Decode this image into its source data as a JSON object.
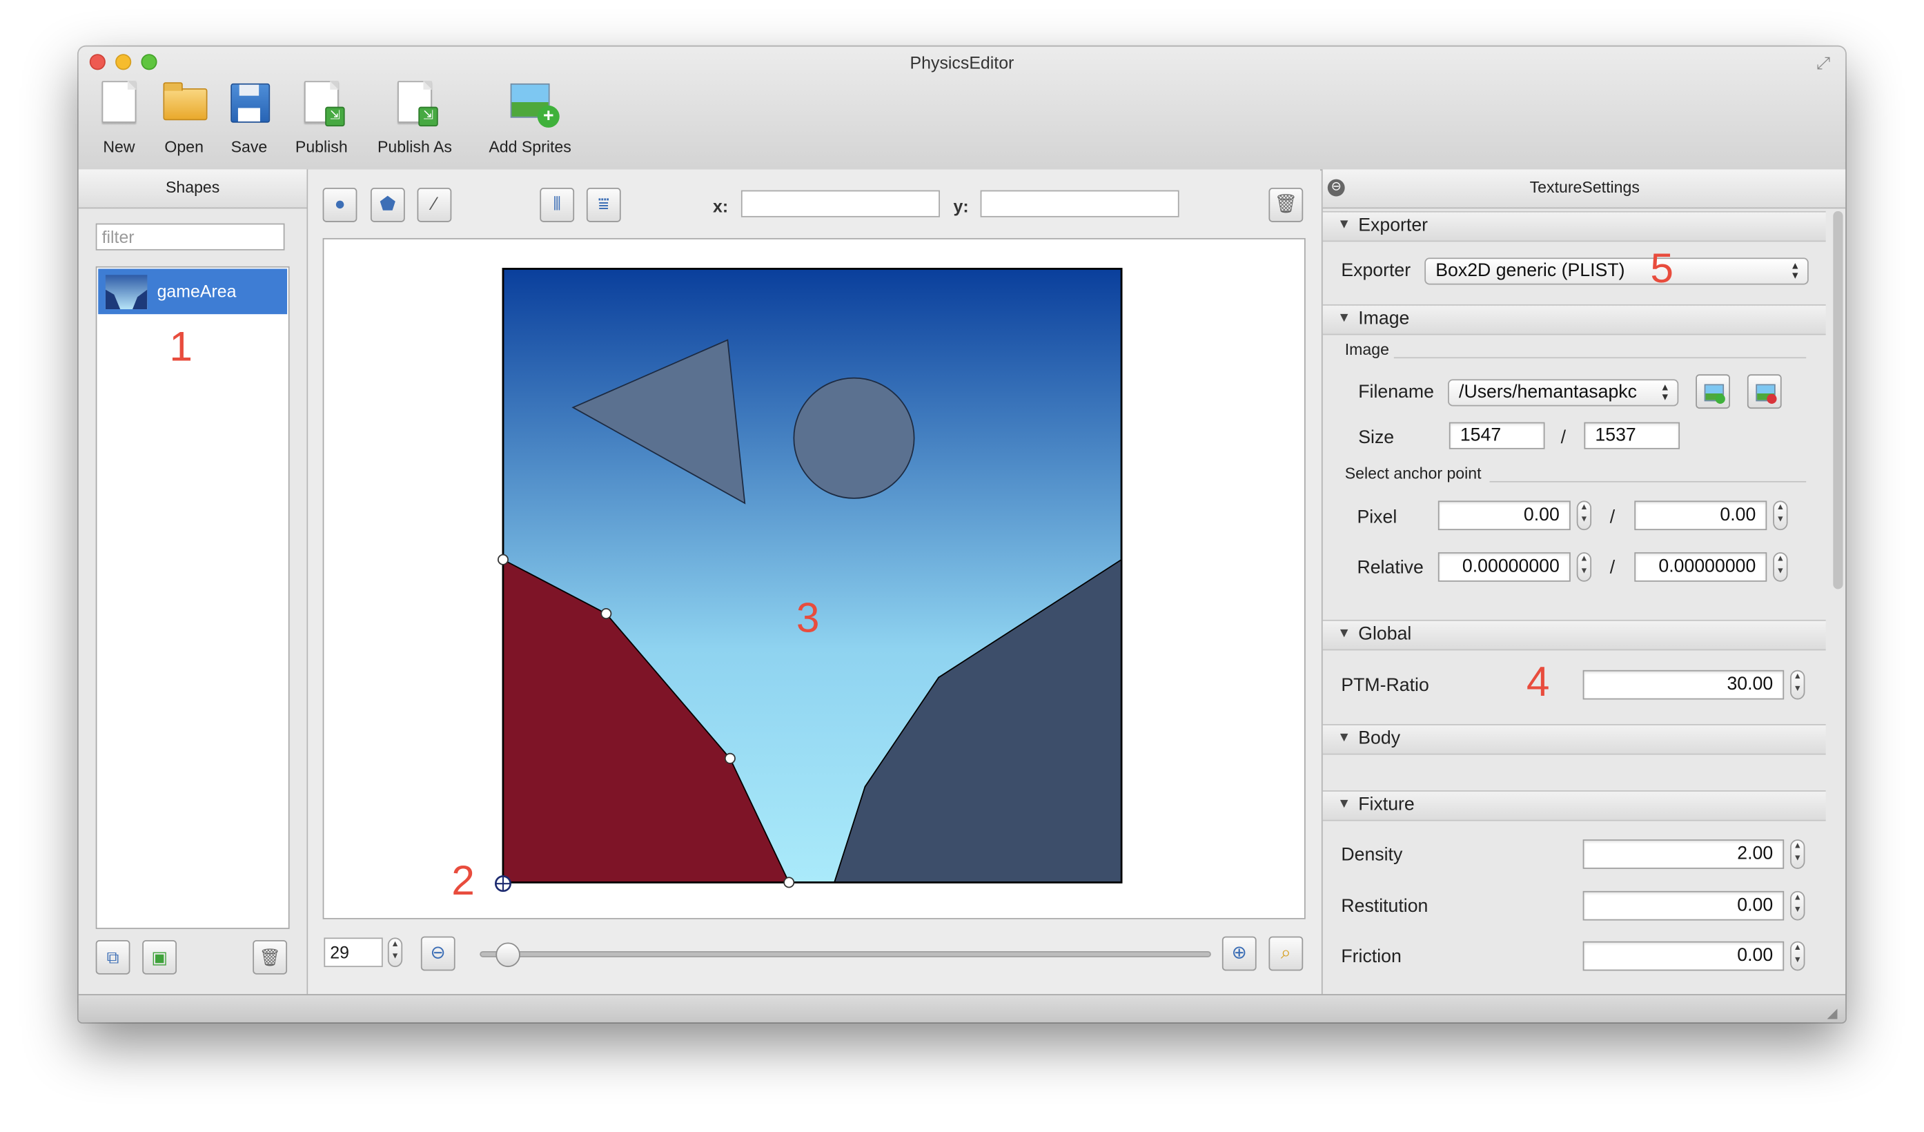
{
  "window": {
    "title": "PhysicsEditor"
  },
  "toolbar": {
    "new": "New",
    "open": "Open",
    "save": "Save",
    "publish": "Publish",
    "publish_as": "Publish As",
    "add_sprites": "Add Sprites"
  },
  "shapes_panel": {
    "title": "Shapes",
    "filter_placeholder": "filter",
    "items": [
      {
        "label": "gameArea",
        "selected": true
      }
    ]
  },
  "canvas_toolbar": {
    "x_label": "x:",
    "y_label": "y:",
    "x_value": "",
    "y_value": ""
  },
  "zoom": {
    "value": "29",
    "slider_level": 0.02
  },
  "annotations": {
    "a1": "1",
    "a2": "2",
    "a3": "3",
    "a4": "4",
    "a5": "5"
  },
  "texture_settings": {
    "title": "TextureSettings",
    "exporter_section": "Exporter",
    "exporter_label": "Exporter",
    "exporter_value": "Box2D generic (PLIST)",
    "image_section": "Image",
    "image_group_label": "Image",
    "filename_label": "Filename",
    "filename_value": "/Users/hemantasapkc",
    "size_label": "Size",
    "size_width": "1547",
    "size_sep": "/",
    "size_height": "1537",
    "anchor_label": "Select anchor point",
    "pixel_label": "Pixel",
    "pixel_x": "0.00",
    "pixel_y": "0.00",
    "pixel_sep": "/",
    "relative_label": "Relative",
    "relative_x": "0.00000000",
    "relative_y": "0.00000000",
    "relative_sep": "/",
    "global_section": "Global",
    "ptm_label": "PTM-Ratio",
    "ptm_value": "30.00",
    "body_section": "Body",
    "fixture_section": "Fixture",
    "density_label": "Density",
    "density_value": "2.00",
    "restitution_label": "Restitution",
    "restitution_value": "0.00",
    "friction_label": "Friction",
    "friction_value": "0.00"
  },
  "colors": {
    "sky_top": "#0a3f9c",
    "sky_bottom": "#aaeafa",
    "left_shape": "#7e1427",
    "right_shape": "#3d4e6a",
    "overlay_shape": "#5b7190",
    "annotation": "#e84c3d",
    "selection": "#3e7dd4"
  }
}
